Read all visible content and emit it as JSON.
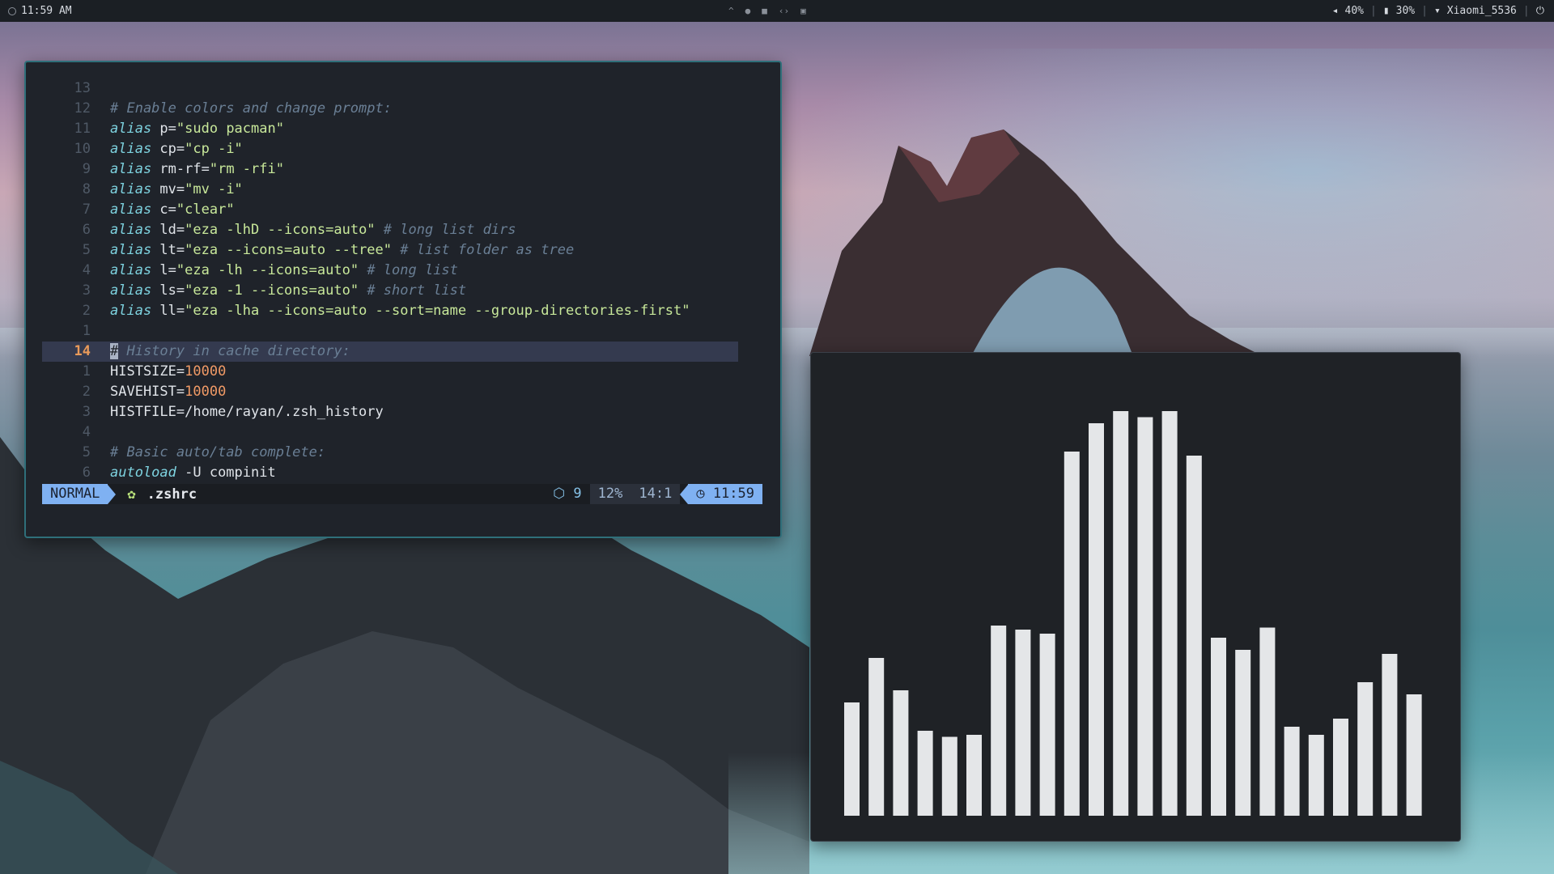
{
  "topbar": {
    "time": "11:59 AM",
    "volume": "40%",
    "battery": "30%",
    "wifi": "Xiaomi_5536"
  },
  "editor": {
    "lines": [
      {
        "num": "13",
        "segments": []
      },
      {
        "num": "12",
        "segments": [
          {
            "t": "# Enable colors and change prompt:",
            "c": "cm"
          }
        ]
      },
      {
        "num": "11",
        "segments": [
          {
            "t": "alias",
            "c": "kw"
          },
          {
            "t": " p=",
            "c": "txt"
          },
          {
            "t": "\"sudo pacman\"",
            "c": "str"
          }
        ]
      },
      {
        "num": "10",
        "segments": [
          {
            "t": "alias",
            "c": "kw"
          },
          {
            "t": " cp=",
            "c": "txt"
          },
          {
            "t": "\"cp -i\"",
            "c": "str"
          }
        ]
      },
      {
        "num": "9",
        "segments": [
          {
            "t": "alias",
            "c": "kw"
          },
          {
            "t": " rm-rf=",
            "c": "txt"
          },
          {
            "t": "\"rm -rfi\"",
            "c": "str"
          }
        ]
      },
      {
        "num": "8",
        "segments": [
          {
            "t": "alias",
            "c": "kw"
          },
          {
            "t": " mv=",
            "c": "txt"
          },
          {
            "t": "\"mv -i\"",
            "c": "str"
          }
        ]
      },
      {
        "num": "7",
        "segments": [
          {
            "t": "alias",
            "c": "kw"
          },
          {
            "t": " c=",
            "c": "txt"
          },
          {
            "t": "\"clear\"",
            "c": "str"
          }
        ]
      },
      {
        "num": "6",
        "segments": [
          {
            "t": "alias",
            "c": "kw"
          },
          {
            "t": " ld=",
            "c": "txt"
          },
          {
            "t": "\"eza -lhD --icons=auto\"",
            "c": "str"
          },
          {
            "t": " # long list dirs",
            "c": "cm"
          }
        ]
      },
      {
        "num": "5",
        "segments": [
          {
            "t": "alias",
            "c": "kw"
          },
          {
            "t": " lt=",
            "c": "txt"
          },
          {
            "t": "\"eza --icons=auto --tree\"",
            "c": "str"
          },
          {
            "t": " # list folder as tree",
            "c": "cm"
          }
        ]
      },
      {
        "num": "4",
        "segments": [
          {
            "t": "alias",
            "c": "kw"
          },
          {
            "t": " l=",
            "c": "txt"
          },
          {
            "t": "\"eza -lh --icons=auto\"",
            "c": "str"
          },
          {
            "t": " # long list",
            "c": "cm"
          }
        ]
      },
      {
        "num": "3",
        "segments": [
          {
            "t": "alias",
            "c": "kw"
          },
          {
            "t": " ls=",
            "c": "txt"
          },
          {
            "t": "\"eza -1 --icons=auto\"",
            "c": "str"
          },
          {
            "t": " # short list",
            "c": "cm"
          }
        ]
      },
      {
        "num": "2",
        "segments": [
          {
            "t": "alias",
            "c": "kw"
          },
          {
            "t": " ll=",
            "c": "txt"
          },
          {
            "t": "\"eza -lha --icons=auto --sort=name --group-directories-first\"",
            "c": "str"
          }
        ]
      },
      {
        "num": "1",
        "segments": []
      },
      {
        "num": "14",
        "current": true,
        "segments": [
          {
            "t": "#",
            "c": "cursor"
          },
          {
            "t": " History in cache directory:",
            "c": "cm"
          }
        ]
      },
      {
        "num": "1",
        "segments": [
          {
            "t": "HISTSIZE=",
            "c": "txt"
          },
          {
            "t": "10000",
            "c": "num"
          }
        ]
      },
      {
        "num": "2",
        "segments": [
          {
            "t": "SAVEHIST=",
            "c": "txt"
          },
          {
            "t": "10000",
            "c": "num"
          }
        ]
      },
      {
        "num": "3",
        "segments": [
          {
            "t": "HISTFILE=/home/rayan/.zsh_history",
            "c": "txt"
          }
        ]
      },
      {
        "num": "4",
        "segments": []
      },
      {
        "num": "5",
        "segments": [
          {
            "t": "# Basic auto/tab complete:",
            "c": "cm"
          }
        ]
      },
      {
        "num": "6",
        "segments": [
          {
            "t": "autoload",
            "c": "kw"
          },
          {
            "t": " -U compinit",
            "c": "txt"
          }
        ]
      }
    ],
    "status": {
      "mode": "NORMAL",
      "filename": ".zshrc",
      "plugins": "9",
      "percent": "12%",
      "position": "14:1",
      "time": "11:59"
    }
  },
  "visualizer": {
    "levels": [
      0.28,
      0.39,
      0.31,
      0.21,
      0.195,
      0.2,
      0.47,
      0.46,
      0.45,
      0.9,
      0.97,
      1.0,
      0.985,
      1.0,
      0.89,
      0.44,
      0.41,
      0.465,
      0.22,
      0.2,
      0.24,
      0.33,
      0.4,
      0.3
    ]
  },
  "colors": {
    "accent": "#7fb1f2",
    "border": "#2f6f7a",
    "editor_bg": "#1f232a",
    "bar": "#e4e6e8"
  }
}
